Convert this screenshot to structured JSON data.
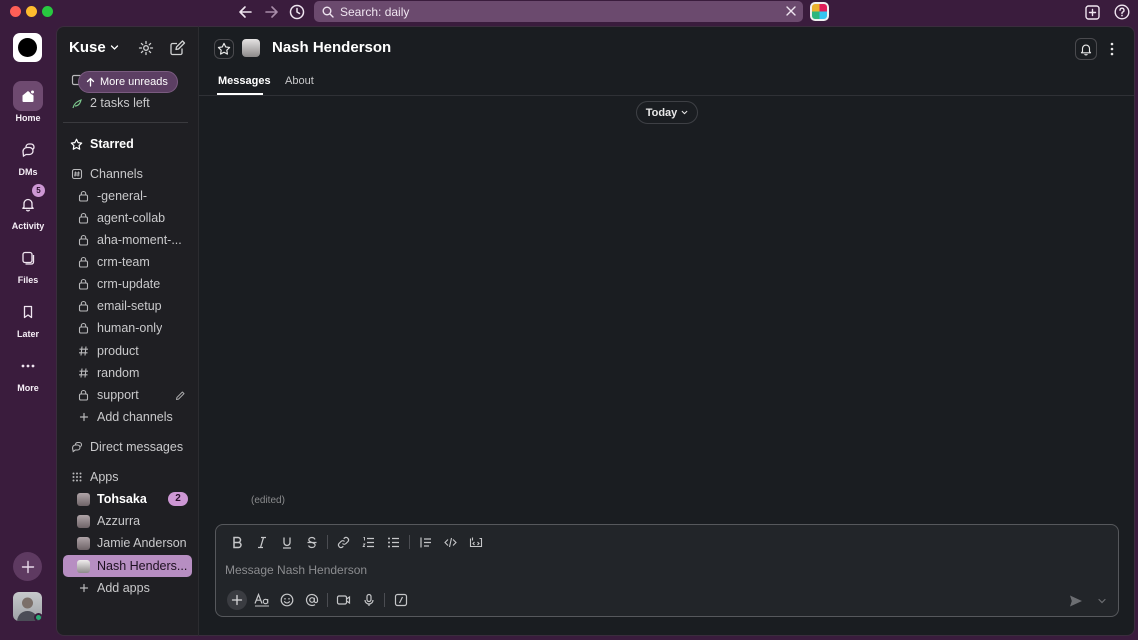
{
  "titlebar": {
    "search_text": "Search: daily"
  },
  "rail": {
    "items": [
      {
        "label": "Home"
      },
      {
        "label": "DMs"
      },
      {
        "label": "Activity",
        "badge": "5"
      },
      {
        "label": "Files"
      },
      {
        "label": "Later"
      },
      {
        "label": "More"
      }
    ]
  },
  "sidebar": {
    "workspace_name": "Kuse",
    "more_unreads": "More unreads",
    "tasks_left": "2 tasks left",
    "starred": "Starred",
    "channels_header": "Channels",
    "channels": [
      {
        "name": "-general-",
        "type": "private"
      },
      {
        "name": "agent-collab",
        "type": "private"
      },
      {
        "name": "aha-moment-...",
        "type": "private"
      },
      {
        "name": "crm-team",
        "type": "private"
      },
      {
        "name": "crm-update",
        "type": "private"
      },
      {
        "name": "email-setup",
        "type": "private"
      },
      {
        "name": "human-only",
        "type": "private"
      },
      {
        "name": "product",
        "type": "public"
      },
      {
        "name": "random",
        "type": "public"
      },
      {
        "name": "support",
        "type": "private"
      }
    ],
    "add_channels": "Add channels",
    "direct_messages": "Direct messages",
    "apps_header": "Apps",
    "apps": [
      {
        "name": "Tohsaka",
        "unread": "2",
        "bold": true
      },
      {
        "name": "Azzurra"
      },
      {
        "name": "Jamie Anderson"
      },
      {
        "name": "Nash Henders...",
        "selected": true
      }
    ],
    "add_apps": "Add apps"
  },
  "main": {
    "title": "Nash Henderson",
    "tabs": [
      "Messages",
      "About"
    ],
    "day_divider": "Today",
    "edited_note": "(edited)",
    "composer_placeholder": "Message Nash Henderson"
  },
  "colors": {
    "aubergine": "#3a1c3d",
    "sidebar_bg": "#1f1f23",
    "main_bg": "#1a1d21",
    "selected_row": "#b78ec2",
    "badge": "#cd97d4"
  }
}
